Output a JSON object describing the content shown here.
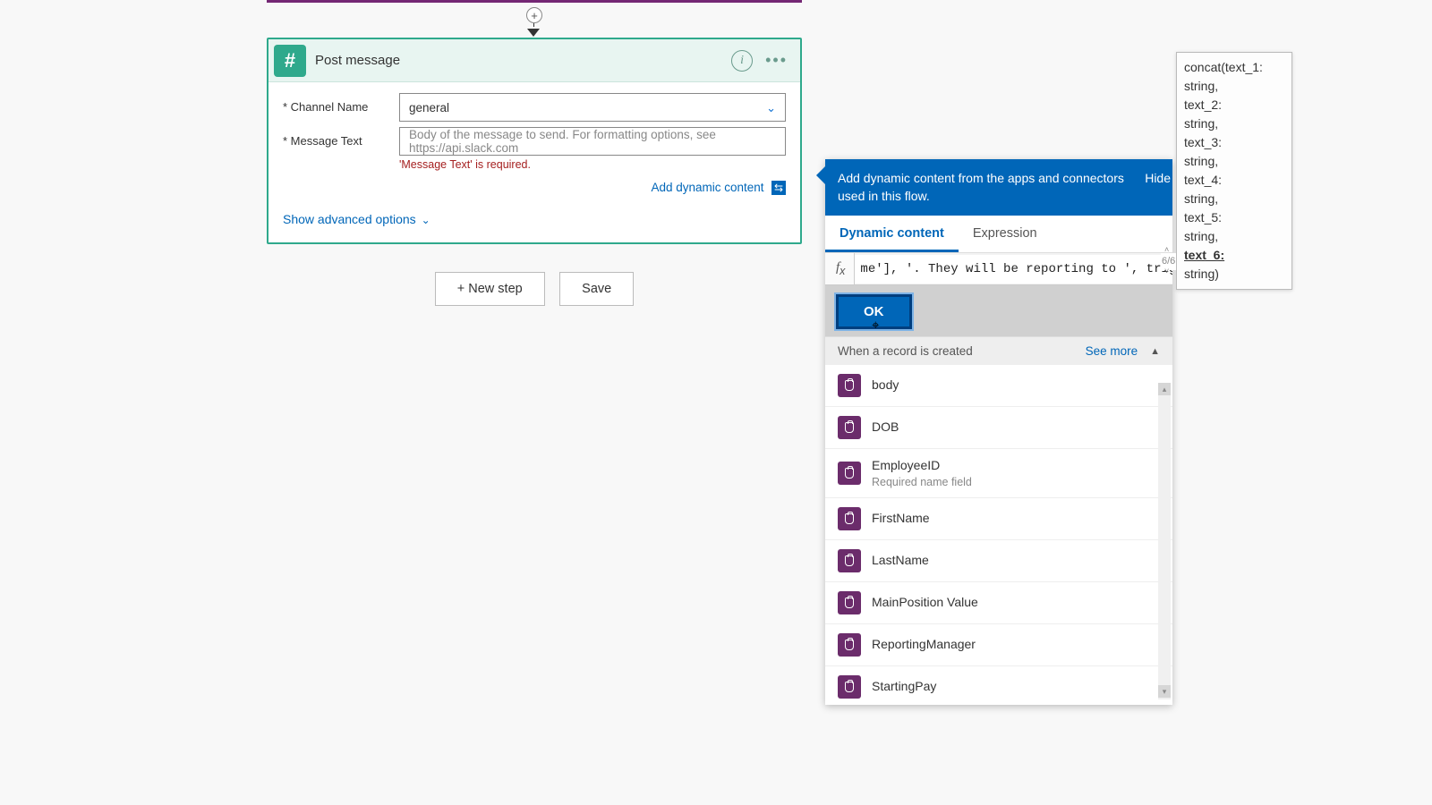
{
  "card": {
    "title": "Post message",
    "icon": "hash-icon",
    "fields": {
      "channel": {
        "label": "Channel Name",
        "value": "general"
      },
      "message": {
        "label": "Message Text",
        "placeholder": "Body of the message to send. For formatting options, see https://api.slack.com",
        "error": "'Message Text' is required."
      }
    },
    "addDynamic": "Add dynamic content",
    "advanced": "Show advanced options"
  },
  "buttons": {
    "newStep": "+ New step",
    "save": "Save"
  },
  "dcPanel": {
    "headerText": "Add dynamic content from the apps and connectors used in this flow.",
    "hide": "Hide",
    "tabs": {
      "dynamic": "Dynamic content",
      "expression": "Expression"
    },
    "fxValue": "me'], '. They will be reporting to ', trig",
    "ok": "OK",
    "sectionTitle": "When a record is created",
    "seeMore": "See more",
    "items": [
      {
        "label": "body"
      },
      {
        "label": "DOB"
      },
      {
        "label": "EmployeeID",
        "sub": "Required name field"
      },
      {
        "label": "FirstName"
      },
      {
        "label": "LastName"
      },
      {
        "label": "MainPosition Value"
      },
      {
        "label": "ReportingManager"
      },
      {
        "label": "StartingPay"
      }
    ]
  },
  "tooltip": {
    "lines": [
      "concat(text_1:",
      "string,",
      "text_2:",
      "string,",
      "text_3:",
      "string,",
      "text_4:",
      "string,",
      "text_5:",
      "string,"
    ],
    "bold": "text_6:",
    "last": "string)",
    "counter": "6/6"
  }
}
